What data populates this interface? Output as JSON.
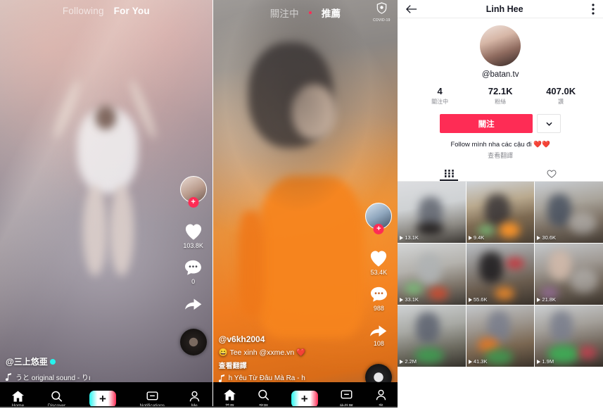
{
  "feed_left": {
    "tabs": [
      {
        "label": "Following",
        "active": false
      },
      {
        "label": "For You",
        "active": true
      }
    ],
    "rail": {
      "avatar_badge": "+",
      "like_count": "103.8K",
      "comment_count": "0",
      "share_count": "",
      "icons": [
        "heart-icon",
        "comment-icon",
        "share-icon",
        "music-disc-icon"
      ]
    },
    "caption": {
      "username": "@三上悠亜",
      "verified": true,
      "music": "うと   original sound - りı",
      "music_icon": "music-note-icon"
    },
    "bottom_nav": [
      {
        "label": "Home",
        "icon": "home-icon",
        "active": true
      },
      {
        "label": "Discover",
        "icon": "search-icon",
        "active": false
      },
      {
        "label": "",
        "icon": "plus-icon",
        "active": false
      },
      {
        "label": "Notifications",
        "icon": "inbox-icon",
        "active": false
      },
      {
        "label": "Me",
        "icon": "person-icon",
        "active": false
      }
    ]
  },
  "feed_right": {
    "tabs": [
      {
        "label": "關注中",
        "active": false
      },
      {
        "label": "推薦",
        "active": true
      }
    ],
    "covid_badge": {
      "label": "COVID-19",
      "icon": "shield-icon"
    },
    "rail": {
      "avatar_badge": "+",
      "like_count": "53.4K",
      "comment_count": "988",
      "share_count": "108"
    },
    "caption": {
      "username": "@v6kh2004",
      "text": "😄 Tee xinh @xxme.vn ❤️",
      "translate": "查看翻譯",
      "music": "h   Yêu Từ Đâu Mà Ra - h",
      "music_icon": "music-note-icon"
    },
    "bottom_nav": [
      {
        "label": "首頁",
        "icon": "home-icon",
        "active": true
      },
      {
        "label": "發現",
        "icon": "search-icon",
        "active": false
      },
      {
        "label": "",
        "icon": "plus-icon",
        "active": false
      },
      {
        "label": "收件匣",
        "icon": "inbox-icon",
        "active": false
      },
      {
        "label": "我",
        "icon": "person-icon",
        "active": false
      }
    ]
  },
  "profile": {
    "header": {
      "back_icon": "back-arrow-icon",
      "title": "Linh Hee",
      "more_icon": "more-vertical-icon"
    },
    "handle": "@batan.tv",
    "stats": [
      {
        "value": "4",
        "label": "關注中"
      },
      {
        "value": "72.1K",
        "label": "粉絲"
      },
      {
        "value": "407.0K",
        "label": "讚"
      }
    ],
    "follow_button": "關注",
    "dropdown_icon": "chevron-down-icon",
    "bio": "Follow mình nha các cậu đi",
    "bio_hearts": "❤️❤️",
    "translate": "查看翻譯",
    "tabs": [
      {
        "icon": "grid-icon",
        "active": true
      },
      {
        "icon": "heart-outline-icon",
        "active": false
      }
    ],
    "videos": [
      {
        "plays": "13.1K"
      },
      {
        "plays": "9.4K"
      },
      {
        "plays": "30.6K"
      },
      {
        "plays": "33.1K"
      },
      {
        "plays": "55.6K"
      },
      {
        "plays": "21.8K"
      },
      {
        "plays": "2.2M"
      },
      {
        "plays": "41.3K"
      },
      {
        "plays": "1.9M"
      }
    ]
  },
  "colors": {
    "brand_red": "#fe2c55",
    "brand_cyan": "#25f4ee",
    "text_dark": "#161823",
    "text_muted": "#8a8b91"
  }
}
